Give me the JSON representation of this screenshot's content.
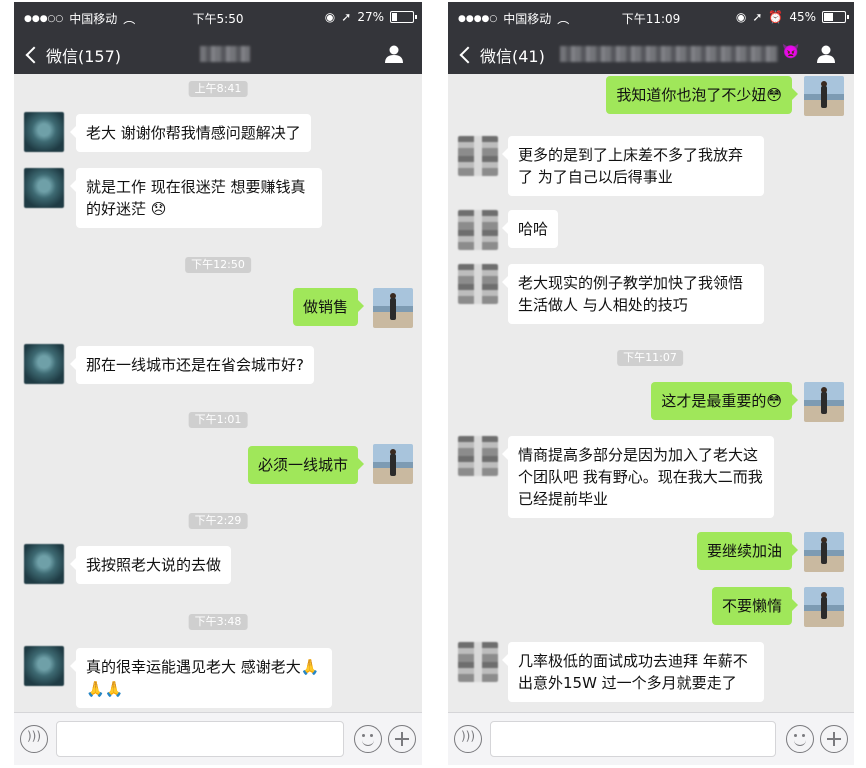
{
  "left_phone": {
    "status": {
      "carrier": "中国移动",
      "time": "下午5:50",
      "battery": "27%",
      "battery_level": 0.27
    },
    "nav": {
      "back_label": "微信(157)"
    },
    "timestamps": [
      "上午8:41",
      "下午12:50",
      "下午1:01",
      "下午2:29",
      "下午3:48"
    ],
    "messages": [
      {
        "from": "other",
        "text": "老大 谢谢你帮我情感问题解决了"
      },
      {
        "from": "other",
        "text": "就是工作  现在很迷茫  想要赚钱真的好迷茫 😞"
      },
      {
        "from": "me",
        "text": "做销售"
      },
      {
        "from": "other",
        "text": "那在一线城市还是在省会城市好?"
      },
      {
        "from": "me",
        "text": "必须一线城市"
      },
      {
        "from": "other",
        "text": "我按照老大说的去做"
      },
      {
        "from": "other",
        "text": "真的很幸运能遇见老大  感谢老大🙏🙏🙏"
      }
    ]
  },
  "right_phone": {
    "status": {
      "carrier": "中国移动",
      "time": "下午11:09",
      "battery": "45%",
      "battery_level": 0.45
    },
    "nav": {
      "back_label": "微信(41)",
      "title_emoji": "👿"
    },
    "timestamps": [
      "下午11:07"
    ],
    "messages": [
      {
        "from": "me",
        "text": "我知道你也泡了不少妞😳"
      },
      {
        "from": "other",
        "text": "更多的是到了上床差不多了我放弃了 为了自己以后得事业"
      },
      {
        "from": "other",
        "text": "哈哈"
      },
      {
        "from": "other",
        "text": "老大现实的例子教学加快了我领悟生活做人 与人相处的技巧"
      },
      {
        "from": "me",
        "text": "这才是最重要的😳"
      },
      {
        "from": "other",
        "text": "情商提高多部分是因为加入了老大这个团队吧 我有野心。现在我大二而我已经提前毕业"
      },
      {
        "from": "me",
        "text": "要继续加油"
      },
      {
        "from": "me",
        "text": "不要懒惰"
      },
      {
        "from": "other",
        "text": "几率极低的面试成功去迪拜 年薪不出意外15W 过一个多月就要走了"
      }
    ]
  },
  "input_bar": {
    "voice_icon": "voice-icon",
    "emoji_icon": "emoji-icon",
    "plus_icon": "plus-icon"
  },
  "colors": {
    "header": "#34353a",
    "chat_bg": "#ebebeb",
    "bubble_me": "#a0e75a",
    "bubble_other": "#ffffff",
    "timestamp_bg": "#cfcfcf"
  }
}
